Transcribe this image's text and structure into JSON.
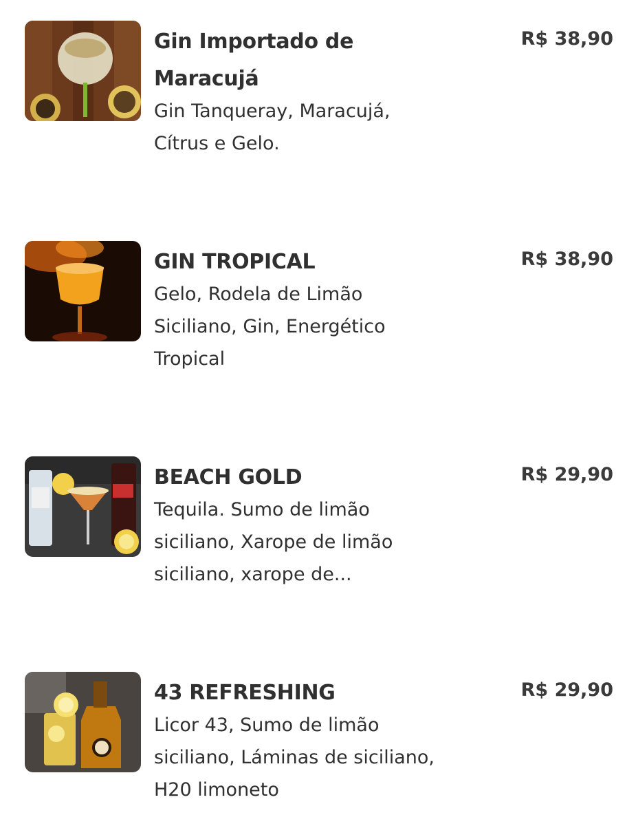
{
  "menu": {
    "items": [
      {
        "name": "Gin Importado de Maracujá",
        "description": "Gin Tanqueray, Maracujá, Cítrus e Gelo.",
        "price": "R$ 38,90"
      },
      {
        "name": "GIN TROPICAL",
        "description": "Gelo, Rodela de Limão Siciliano, Gin, Energético Tropical",
        "price": "R$ 38,90"
      },
      {
        "name": "BEACH GOLD",
        "description": "Tequila. Sumo de limão siciliano, Xarope de limão siciliano, xarope de...",
        "price": "R$ 29,90"
      },
      {
        "name": "43 REFRESHING",
        "description": "Licor 43, Sumo de limão siciliano, Láminas de siciliano, H20 limoneto",
        "price": "R$ 29,90"
      }
    ]
  },
  "colors": {
    "text": "#303030",
    "background": "#ffffff"
  }
}
